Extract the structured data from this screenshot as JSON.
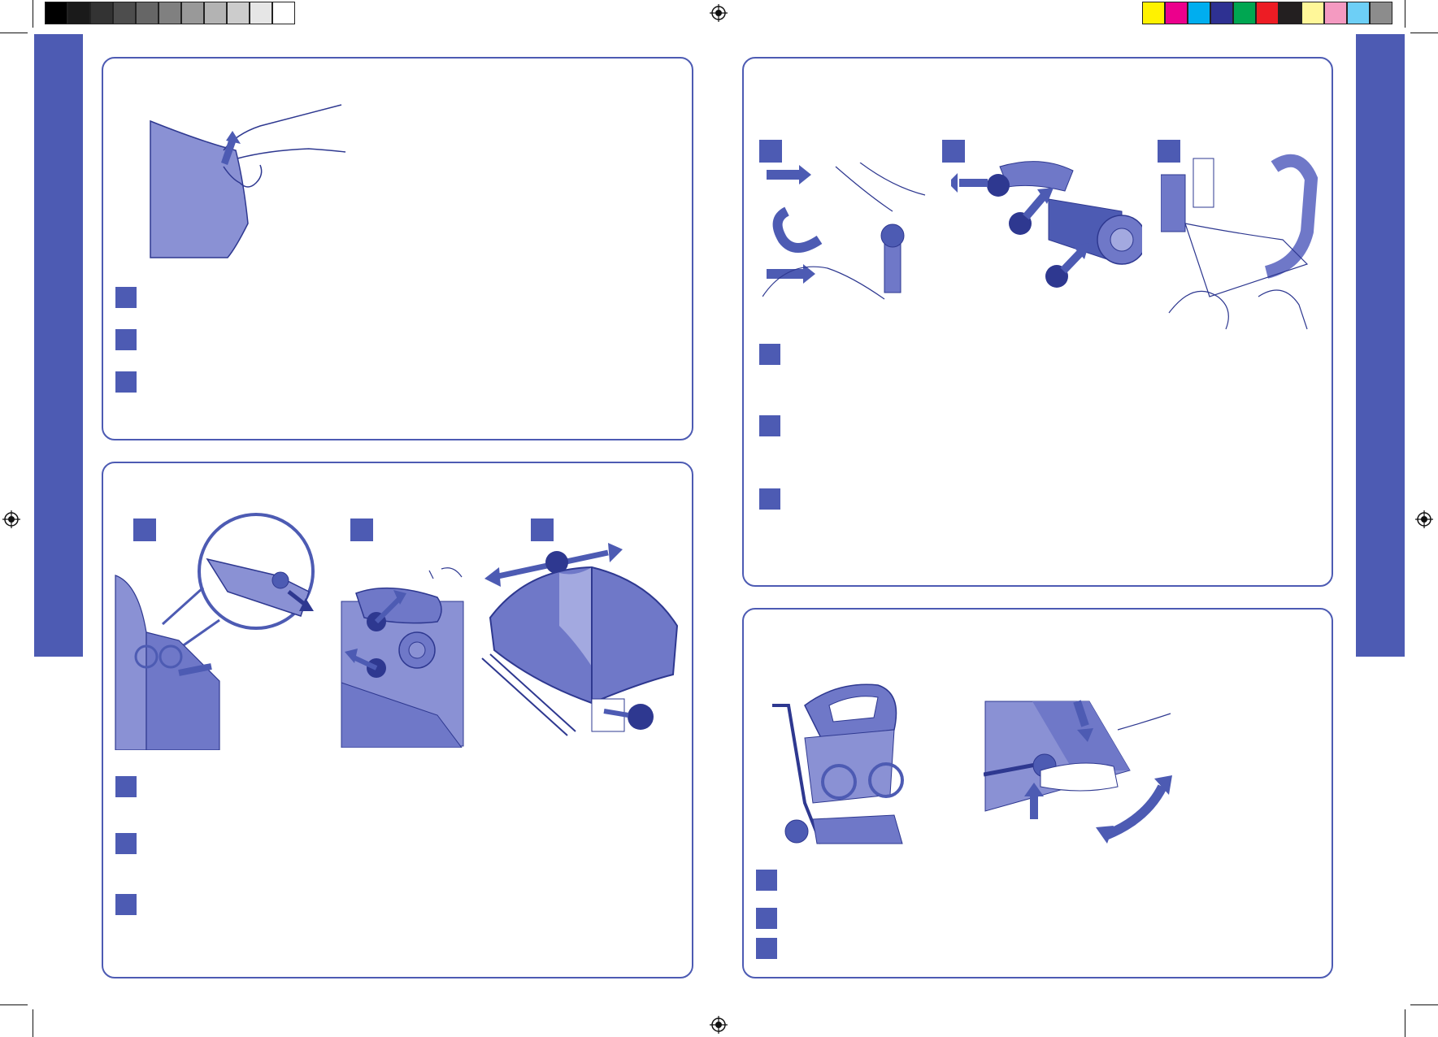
{
  "colors": {
    "accent": "#4d5bb3",
    "fill_light": "#8a91d4",
    "fill_mid": "#6f78c8",
    "line": "#2e3890"
  },
  "print_marks": {
    "gray_bar": [
      "#000000",
      "#1a1a1a",
      "#333333",
      "#4d4d4d",
      "#666666",
      "#808080",
      "#999999",
      "#b3b3b3",
      "#cccccc",
      "#e6e6e6",
      "#ffffff"
    ],
    "color_bar": [
      "#fff200",
      "#ec008c",
      "#00aeef",
      "#2e3192",
      "#00a651",
      "#ed1c24",
      "#231f20",
      "#fff799",
      "#f49ac1",
      "#6dcff6",
      "#8c8c8c"
    ]
  },
  "panels": [
    {
      "name": "panel-top-left",
      "markers": 3,
      "step_squares": 3
    },
    {
      "name": "panel-bottom-left",
      "markers": 3,
      "step_squares": 3
    },
    {
      "name": "panel-top-right",
      "markers": 3,
      "step_squares": 3
    },
    {
      "name": "panel-bottom-right",
      "markers": 0,
      "step_squares": 3
    }
  ],
  "icons": [
    "registration-mark-icon",
    "arrow-icon",
    "step-marker-icon"
  ]
}
